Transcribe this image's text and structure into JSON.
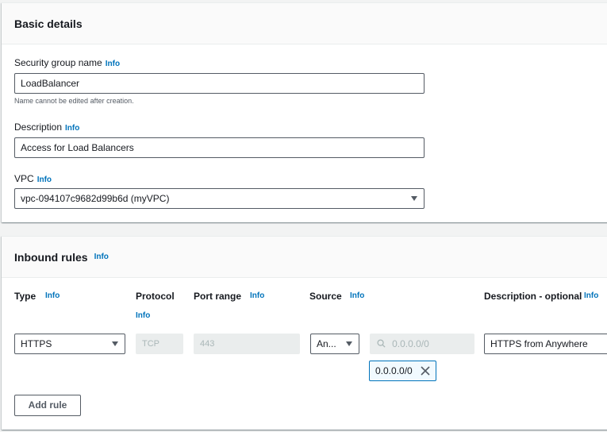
{
  "basic_details": {
    "title": "Basic details",
    "sg_name": {
      "label": "Security group name",
      "info": "Info",
      "value": "LoadBalancer",
      "hint": "Name cannot be edited after creation."
    },
    "description": {
      "label": "Description",
      "info": "Info",
      "value": "Access for Load Balancers"
    },
    "vpc": {
      "label": "VPC",
      "info": "Info",
      "value": "vpc-094107c9682d99b6d (myVPC)"
    }
  },
  "inbound_rules": {
    "title": "Inbound rules",
    "info": "Info",
    "columns": {
      "type": "Type",
      "type_info": "Info",
      "protocol": "Protocol",
      "protocol_info": "Info",
      "port_range": "Port range",
      "port_range_info": "Info",
      "source": "Source",
      "source_info": "Info",
      "description": "Description - optional",
      "description_info": "Info"
    },
    "row": {
      "type": "HTTPS",
      "protocol": "TCP",
      "port_range": "443",
      "source_select": "An...",
      "source_search_placeholder": "0.0.0.0/0",
      "source_token": "0.0.0.0/0",
      "description": "HTTPS from Anywhere"
    },
    "add_rule": "Add rule"
  },
  "icons": {
    "search": "search-icon",
    "close": "close-icon",
    "dropdown": "caret-down-icon"
  },
  "colors": {
    "link": "#0073bb",
    "border": "#545b64",
    "token_bg": "#f1faff"
  }
}
